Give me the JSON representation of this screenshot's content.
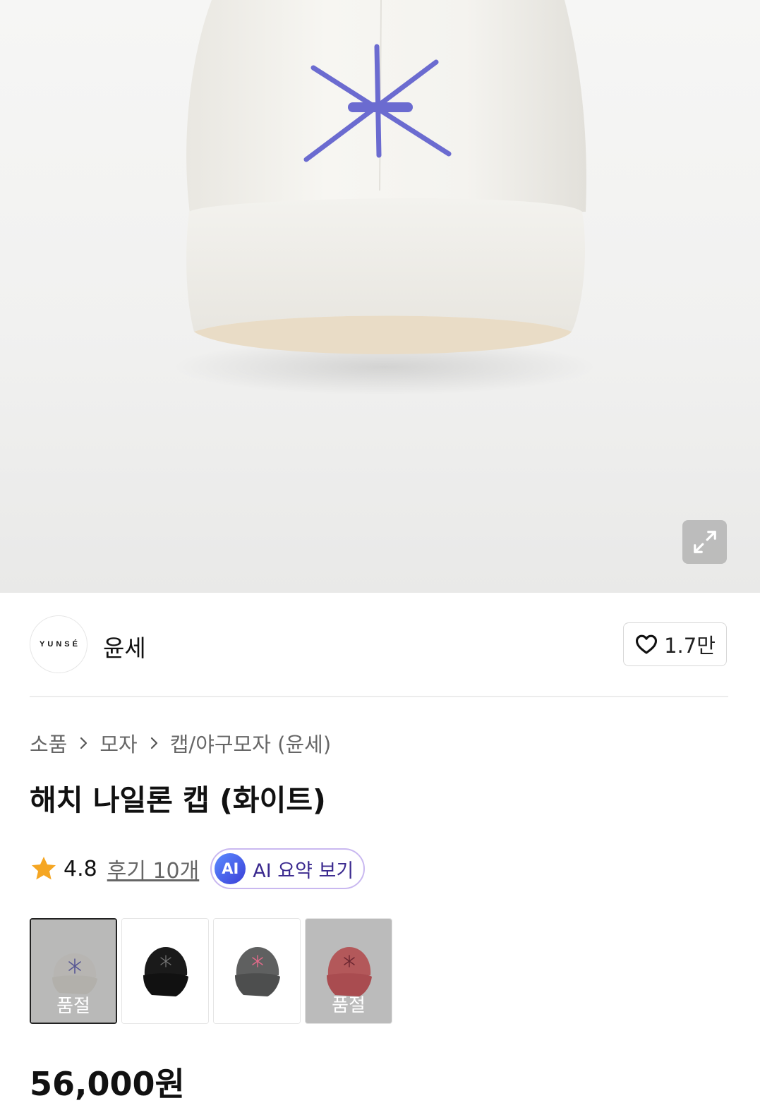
{
  "brand": {
    "logo_text": "YUNSÉ",
    "name": "윤세"
  },
  "like": {
    "count": "1.7만"
  },
  "breadcrumb": [
    "소품",
    "모자",
    "캡/야구모자 (윤세)"
  ],
  "product": {
    "title": "해치 나일론 캡 (화이트)",
    "rating": "4.8",
    "reviews": "후기 10개",
    "price": "56,000원"
  },
  "ai_summary": {
    "badge": "AI",
    "label": "AI 요약 보기"
  },
  "swatches": [
    {
      "color": "white",
      "sold_out_label": "품절"
    },
    {
      "color": "black"
    },
    {
      "color": "charcoal"
    },
    {
      "color": "red",
      "sold_out_label": "품절"
    }
  ],
  "icons": [
    "expand-icon",
    "heart-icon",
    "chevron-right-icon",
    "star-icon"
  ],
  "colors": {
    "accent_star": "#f5a623",
    "ai_border": "#c9b8f0",
    "ai_text": "#3b2a8f",
    "embroidery": "#6b6bd0"
  }
}
